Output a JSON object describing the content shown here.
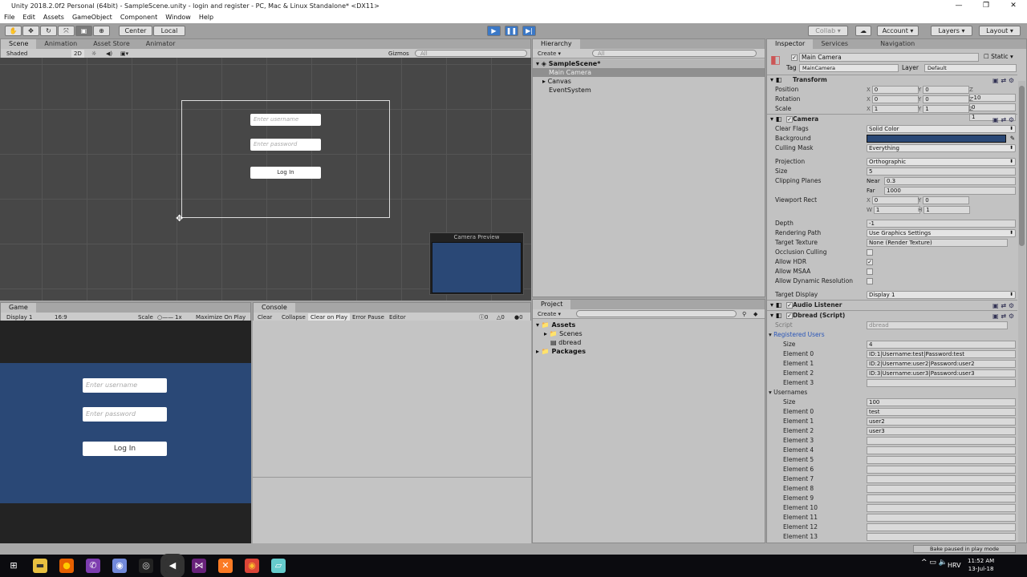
{
  "window": {
    "title": "Unity 2018.2.0f2 Personal (64bit) - SampleScene.unity - login and register - PC, Mac & Linux Standalone* <DX11>",
    "minimize": "—",
    "restore": "❐",
    "close": "✕"
  },
  "menu": [
    "File",
    "Edit",
    "Assets",
    "GameObject",
    "Component",
    "Window",
    "Help"
  ],
  "toolbar": {
    "pivot": "Center",
    "space": "Local",
    "collab": "Collab",
    "account": "Account",
    "layers": "Layers",
    "layout": "Layout",
    "play_state": "playing-paused"
  },
  "scene": {
    "tabs": [
      "Scene",
      "Animation",
      "Asset Store",
      "Animator"
    ],
    "shading": "Shaded",
    "mode2d": "2D",
    "gizmos": "Gizmos",
    "search_placeholder": "All",
    "username_placeholder": "Enter username",
    "password_placeholder": "Enter password",
    "login_label": "Log In",
    "camera_preview_title": "Camera Preview"
  },
  "game": {
    "tab": "Game",
    "display": "Display 1",
    "aspect": "16:9",
    "scale_label": "Scale",
    "scale_value": "1x",
    "maximize": "Maximize On Play",
    "username_placeholder": "Enter username",
    "password_placeholder": "Enter password",
    "login_label": "Log In",
    "bg_color": "#2a4876"
  },
  "console": {
    "tab": "Console",
    "buttons": [
      "Clear",
      "Collapse",
      "Clear on Play",
      "Error Pause",
      "Editor"
    ],
    "info_count": "0",
    "warn_count": "0",
    "error_count": "0"
  },
  "hierarchy": {
    "tab": "Hierarchy",
    "create": "Create",
    "search_placeholder": "All",
    "scene": "SampleScene*",
    "items": [
      "Main Camera",
      "Canvas",
      "EventSystem"
    ]
  },
  "project": {
    "tab": "Project",
    "create": "Create",
    "items": [
      "Assets",
      "Scenes",
      "dbread",
      "Packages"
    ]
  },
  "inspector": {
    "tabs": [
      "Inspector",
      "Services",
      "Navigation"
    ],
    "object_name": "Main Camera",
    "static_label": "Static",
    "tag_label": "Tag",
    "tag": "MainCamera",
    "layer_label": "Layer",
    "layer": "Default",
    "rows": [
      {
        "type": "head",
        "label": "Transform"
      },
      {
        "type": "vec3",
        "label": "Position",
        "x": "0",
        "y": "0",
        "z": "-10"
      },
      {
        "type": "vec3",
        "label": "Rotation",
        "x": "0",
        "y": "0",
        "z": "0"
      },
      {
        "type": "vec3",
        "label": "Scale",
        "x": "1",
        "y": "1",
        "z": "1"
      },
      {
        "type": "head",
        "label": "Camera"
      },
      {
        "type": "dd",
        "label": "Clear Flags",
        "value": "Solid Color"
      },
      {
        "type": "color",
        "label": "Background",
        "value": "#2a4876"
      },
      {
        "type": "dd",
        "label": "Culling Mask",
        "value": "Everything"
      },
      {
        "type": "gap"
      },
      {
        "type": "dd",
        "label": "Projection",
        "value": "Orthographic"
      },
      {
        "type": "field",
        "label": "Size",
        "value": "5"
      },
      {
        "type": "pre",
        "label": "Clipping Planes",
        "prefix": "Near",
        "value": "0.3"
      },
      {
        "type": "pre",
        "label": "",
        "prefix": "Far",
        "value": "1000"
      },
      {
        "type": "vec2",
        "label": "Viewport Rect",
        "a": "X",
        "av": "0",
        "b": "Y",
        "bv": "0"
      },
      {
        "type": "vec2",
        "label": "",
        "a": "W",
        "av": "1",
        "b": "H",
        "bv": "1"
      },
      {
        "type": "gap"
      },
      {
        "type": "field",
        "label": "Depth",
        "value": "-1"
      },
      {
        "type": "dd",
        "label": "Rendering Path",
        "value": "Use Graphics Settings"
      },
      {
        "type": "field",
        "label": "Target Texture",
        "value": "None (Render Texture)"
      },
      {
        "type": "check",
        "label": "Occlusion Culling",
        "checked": false
      },
      {
        "type": "check",
        "label": "Allow HDR",
        "checked": true
      },
      {
        "type": "check",
        "label": "Allow MSAA",
        "checked": false
      },
      {
        "type": "check",
        "label": "Allow Dynamic Resolution",
        "checked": false
      },
      {
        "type": "gap"
      },
      {
        "type": "dd",
        "label": "Target Display",
        "value": "Display 1"
      },
      {
        "type": "head",
        "label": "Audio Listener"
      },
      {
        "type": "head",
        "label": "Dbread (Script)"
      },
      {
        "type": "field",
        "label": "Script",
        "value": "dbread",
        "dim": true
      },
      {
        "type": "section",
        "label": "Registered Users",
        "blue": true
      },
      {
        "type": "field",
        "label": "Size",
        "value": "4",
        "indent": true
      },
      {
        "type": "field",
        "label": "Element 0",
        "value": "ID:1|Username:test|Password:test",
        "indent": true
      },
      {
        "type": "field",
        "label": "Element 1",
        "value": "ID:2|Username:user2|Password:user2",
        "indent": true
      },
      {
        "type": "field",
        "label": "Element 2",
        "value": "ID:3|Username:user3|Password:user3",
        "indent": true
      },
      {
        "type": "field",
        "label": "Element 3",
        "value": "",
        "indent": true
      },
      {
        "type": "section",
        "label": "Usernames"
      },
      {
        "type": "field",
        "label": "Size",
        "value": "100",
        "indent": true
      },
      {
        "type": "field",
        "label": "Element 0",
        "value": "test",
        "indent": true
      },
      {
        "type": "field",
        "label": "Element 1",
        "value": "user2",
        "indent": true
      },
      {
        "type": "field",
        "label": "Element 2",
        "value": "user3",
        "indent": true
      },
      {
        "type": "field",
        "label": "Element 3",
        "value": "",
        "indent": true
      },
      {
        "type": "field",
        "label": "Element 4",
        "value": "",
        "indent": true
      },
      {
        "type": "field",
        "label": "Element 5",
        "value": "",
        "indent": true
      },
      {
        "type": "field",
        "label": "Element 6",
        "value": "",
        "indent": true
      },
      {
        "type": "field",
        "label": "Element 7",
        "value": "",
        "indent": true
      },
      {
        "type": "field",
        "label": "Element 8",
        "value": "",
        "indent": true
      },
      {
        "type": "field",
        "label": "Element 9",
        "value": "",
        "indent": true
      },
      {
        "type": "field",
        "label": "Element 10",
        "value": "",
        "indent": true
      },
      {
        "type": "field",
        "label": "Element 11",
        "value": "",
        "indent": true
      },
      {
        "type": "field",
        "label": "Element 12",
        "value": "",
        "indent": true
      },
      {
        "type": "field",
        "label": "Element 13",
        "value": "",
        "indent": true
      }
    ]
  },
  "status": {
    "message": "Bake paused in play mode"
  },
  "taskbar": {
    "apps": [
      "windows-start",
      "file-explorer",
      "firefox",
      "viber",
      "discord",
      "obs",
      "unity",
      "visual-studio",
      "xampp",
      "chrome",
      "notepad"
    ],
    "tray_lang": "HRV",
    "time": "11:52 AM",
    "date": "13-Jul-18"
  }
}
